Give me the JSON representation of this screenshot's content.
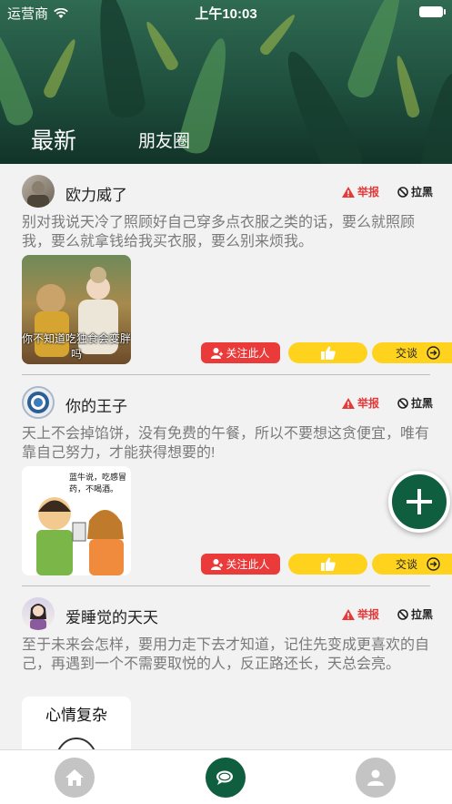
{
  "status_bar": {
    "carrier": "运营商",
    "time": "上午10:03"
  },
  "tabs": {
    "latest": "最新",
    "friends": "朋友圈"
  },
  "actions": {
    "report": "举报",
    "block": "拉黑",
    "follow": "关注此人",
    "chat": "交谈"
  },
  "posts": [
    {
      "username": "欧力威了",
      "text": "别对我说天冷了照顾好自己穿多点衣服之类的话，要么就照顾我，要么就拿钱给我买衣服，要么别来烦我。",
      "image_caption": "你不知道吃独食会变胖吗"
    },
    {
      "username": "你的王子",
      "text": "天上不会掉馅饼，没有免费的午餐，所以不要想这贪便宜，唯有靠自己努力，才能获得想要的!",
      "image_caption": "",
      "comic_bubble": "蓝牛说，吃感冒药，不喝酒。"
    },
    {
      "username": "爱睡觉的天天",
      "text": "至于未来会怎样，要用力走下去才知道，记住先变成更喜欢的自己，再遇到一个不需要取悦的人，反正路还长，天总会亮。",
      "image_caption": "心情复杂"
    }
  ],
  "colors": {
    "accent_green": "#0f5e3f",
    "report_red": "#e23b3b",
    "follow_red": "#ea3a3a",
    "yellow": "#ffd21e"
  }
}
